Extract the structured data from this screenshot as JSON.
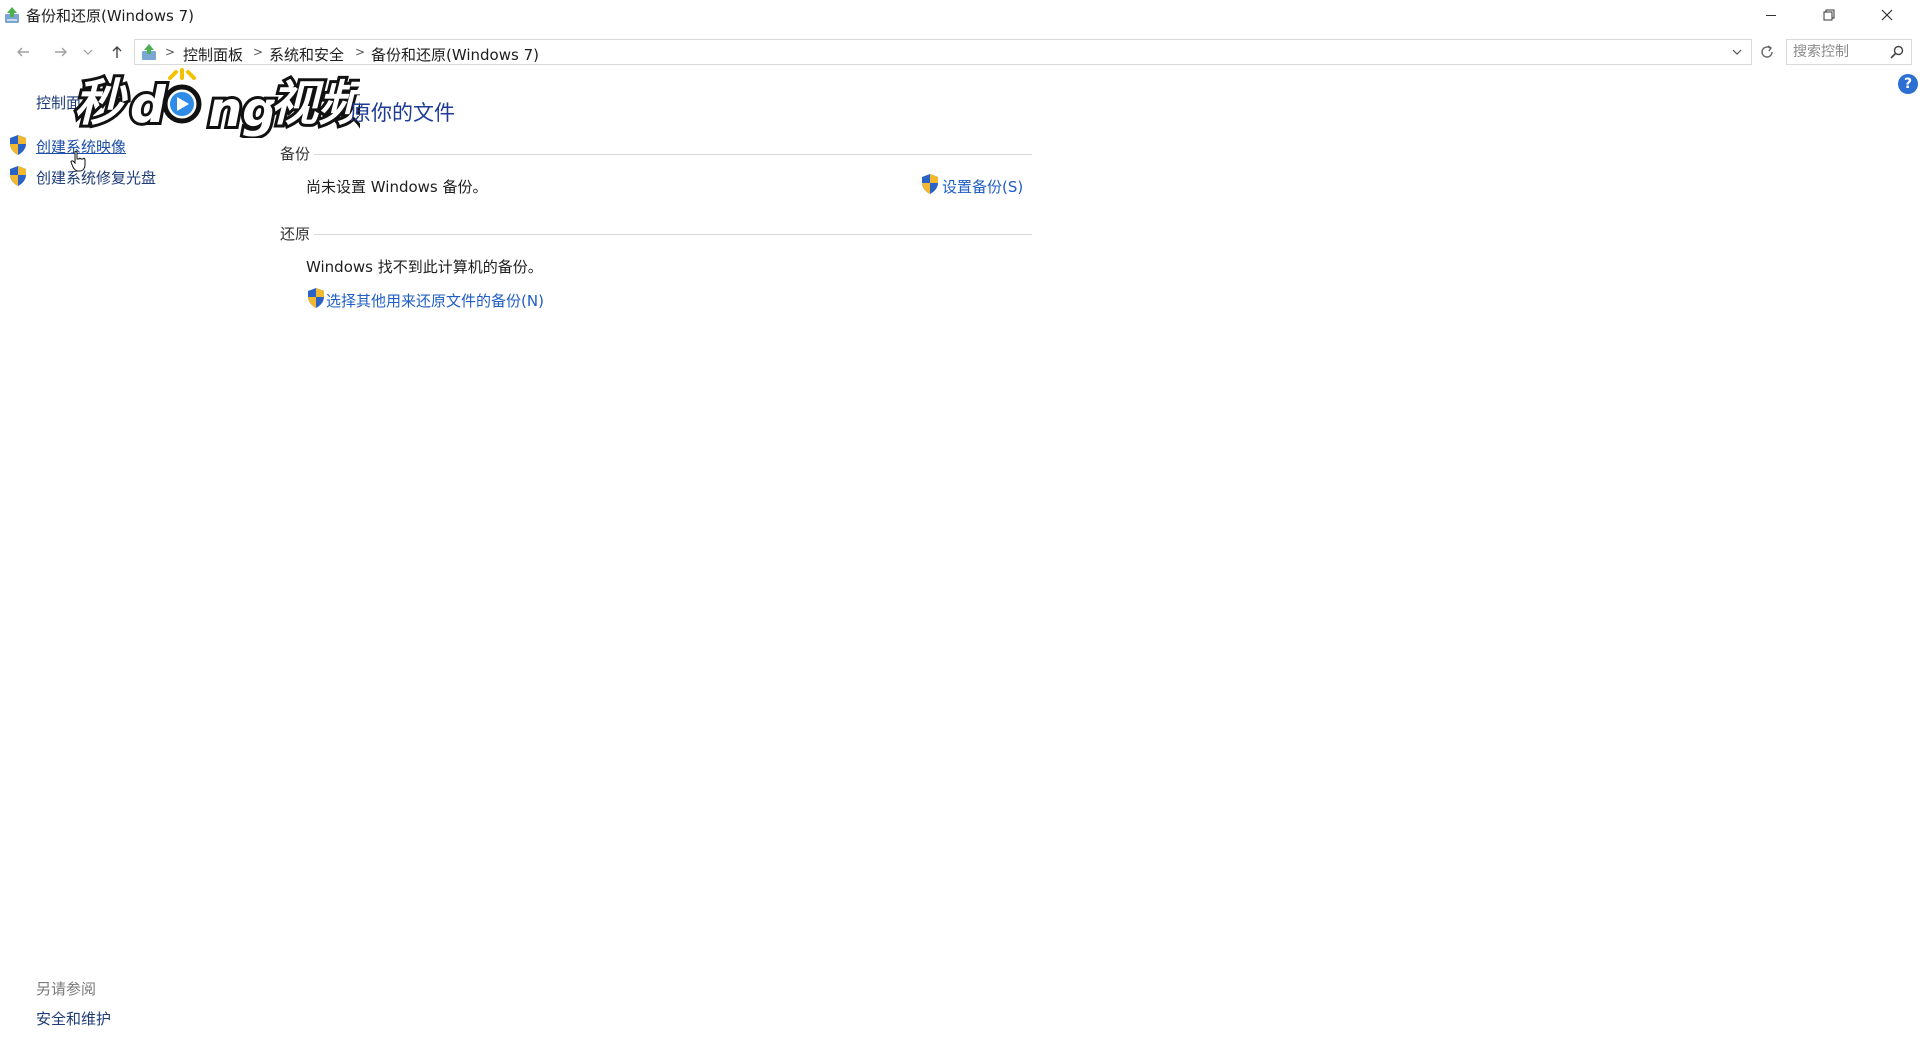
{
  "window": {
    "title": "备份和还原(Windows 7)",
    "icon": "backup-restore-icon"
  },
  "address_bar": {
    "breadcrumbs": [
      "控制面板",
      "系统和安全",
      "备份和还原(Windows 7)"
    ],
    "search_placeholder": "搜索控制"
  },
  "sidebar": {
    "home_label": "控制面",
    "links": [
      {
        "label": "创建系统映像",
        "icon": "shield-icon"
      },
      {
        "label": "创建系统修复光盘",
        "icon": "shield-icon"
      }
    ]
  },
  "watermark": {
    "text_part1": "秒",
    "text_part2": "d",
    "text_part3": "ng",
    "text_part4": "视频"
  },
  "main": {
    "title_fragment": "原你的文件",
    "backup": {
      "section_label": "备份",
      "status_text": "尚未设置 Windows 备份。",
      "action_label": "设置备份(S)"
    },
    "restore": {
      "section_label": "还原",
      "status_text": "Windows 找不到此计算机的备份。",
      "action_label": "选择其他用来还原文件的备份(N)"
    }
  },
  "see_also": {
    "title": "另请参阅",
    "link": "安全和维护"
  },
  "help_label": "?",
  "colors": {
    "link_blue": "#1f5ec4",
    "title_blue": "#1e3c96",
    "shield_blue": "#2b62c7",
    "shield_yellow": "#f2b82f"
  }
}
